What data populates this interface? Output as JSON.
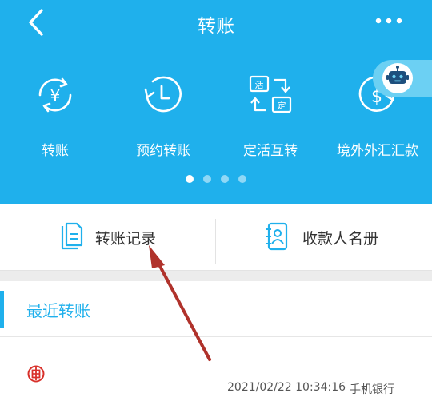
{
  "header": {
    "title": "转账"
  },
  "functions": [
    {
      "label": "转账",
      "icon": "yen-exchange-icon"
    },
    {
      "label": "预约转账",
      "icon": "clock-refresh-icon"
    },
    {
      "label": "定活互转",
      "icon": "fixed-current-swap-icon"
    },
    {
      "label": "境外外汇汇款",
      "icon": "dollar-exchange-icon"
    }
  ],
  "carousel": {
    "page_count": 4,
    "active_page": 1
  },
  "tabs": {
    "records": {
      "label": "转账记录",
      "icon": "document-icon"
    },
    "payees": {
      "label": "收款人名册",
      "icon": "contact-book-icon"
    }
  },
  "recent": {
    "title": "最近转账",
    "items": [
      {
        "time": "2021/02/22 10:34:16",
        "channel": "手机银行",
        "bank_icon": "icbc-logo-icon"
      }
    ]
  },
  "colors": {
    "primary": "#1fb0ec",
    "annotation_arrow": "#b0322b"
  }
}
